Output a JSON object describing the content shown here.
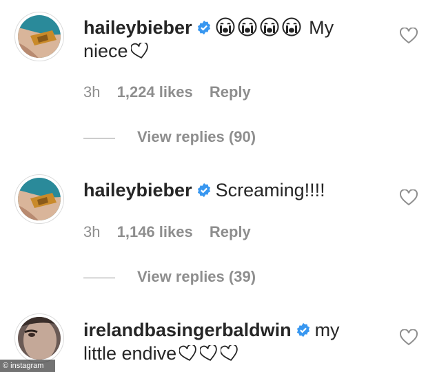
{
  "comments": [
    {
      "username": "haileybieber",
      "text_after_emoji": "My",
      "text_line2": "niece",
      "time": "3h",
      "likes": "1,224 likes",
      "reply": "Reply",
      "view_replies": "View replies (90)"
    },
    {
      "username": "haileybieber",
      "text": "Screaming!!!!",
      "time": "3h",
      "likes": "1,146 likes",
      "reply": "Reply",
      "view_replies": "View replies (39)"
    },
    {
      "username": "irelandbasingerbaldwin",
      "text_after_name": "my",
      "text_line2": "little endive"
    }
  ],
  "watermark": "© instagram",
  "colors": {
    "verified": "#3897f0",
    "muted": "#8e8e8e",
    "text": "#262626"
  }
}
